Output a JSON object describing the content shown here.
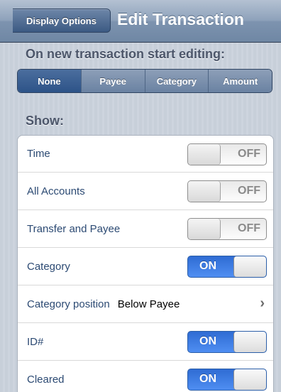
{
  "navbar": {
    "back_label": "Display Options",
    "title": "Edit Transaction"
  },
  "editing_section": {
    "header": "On new transaction start editing:",
    "segments": [
      {
        "label": "None",
        "selected": true
      },
      {
        "label": "Payee",
        "selected": false
      },
      {
        "label": "Category",
        "selected": false
      },
      {
        "label": "Amount",
        "selected": false
      }
    ]
  },
  "show_section": {
    "header": "Show:",
    "rows": [
      {
        "label": "Time",
        "switch": "OFF"
      },
      {
        "label": "All Accounts",
        "switch": "OFF"
      },
      {
        "label": "Transfer and Payee",
        "switch": "OFF"
      },
      {
        "label": "Category",
        "switch": "ON"
      },
      {
        "label": "Category position",
        "value": "Below Payee",
        "chevron": "›"
      },
      {
        "label": "ID#",
        "switch": "ON"
      },
      {
        "label": "Cleared",
        "switch": "ON"
      }
    ]
  },
  "colors": {
    "accent_blue": "#2f6cd3",
    "nav_blue": "#7d93af",
    "label_blue": "#2c4a73"
  }
}
